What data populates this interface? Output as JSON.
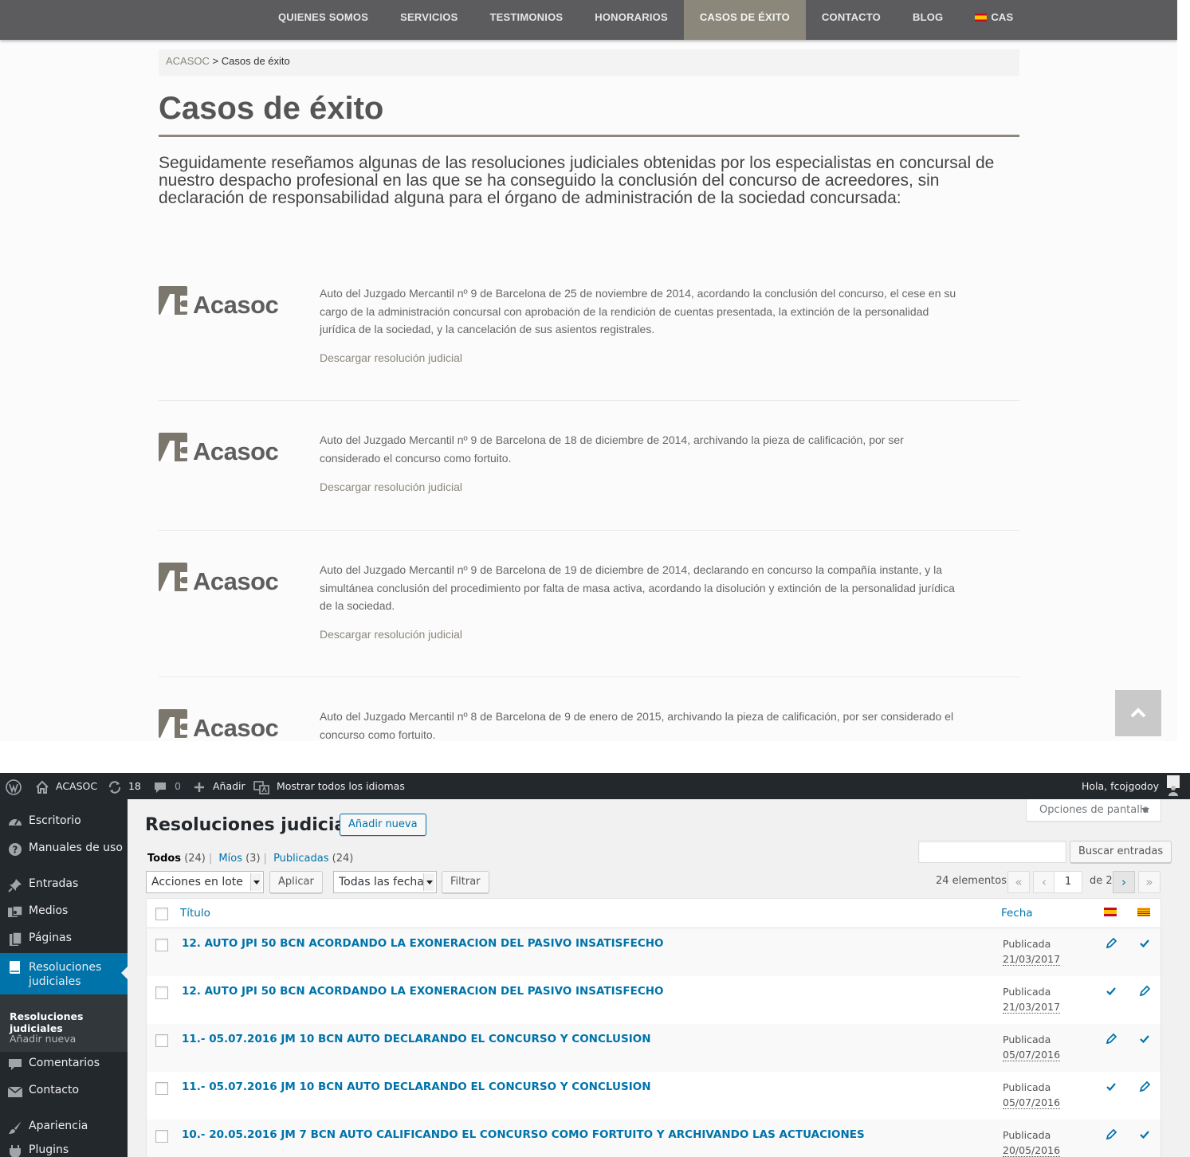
{
  "site": {
    "nav": [
      {
        "label": "QUIENES SOMOS",
        "active": false
      },
      {
        "label": "SERVICIOS",
        "active": false
      },
      {
        "label": "TESTIMONIOS",
        "active": false
      },
      {
        "label": "HONORARIOS",
        "active": false
      },
      {
        "label": "CASOS DE ÉXITO",
        "active": true
      },
      {
        "label": "CONTACTO",
        "active": false
      },
      {
        "label": "BLOG",
        "active": false
      }
    ],
    "language": "CAS",
    "breadcrumb": {
      "home": "ACASOC",
      "separator": ">",
      "current": "Casos de éxito"
    },
    "title": "Casos de éxito",
    "intro": "Seguidamente reseñamos algunas de las resoluciones judiciales obtenidas por los especialistas en concursal de nuestro despacho profesional en las que se ha conseguido la conclusión del concurso de acreedores, sin declaración de responsabilidad alguna para el órgano de administración de la sociedad concursada:",
    "logo_text": "Acasoc",
    "download_label": "Descargar resolución judicial",
    "cases": [
      {
        "text": "Auto del Juzgado Mercantil nº 9 de Barcelona de 25 de noviembre de 2014, acordando la conclusión del concurso, el cese en su cargo de la administración concursal con aprobación de la rendición de cuentas presentada, la extinción de la personalidad jurídica de la sociedad, y la cancelación de sus asientos registrales."
      },
      {
        "text": "Auto del Juzgado Mercantil nº 9 de Barcelona de 18 de diciembre de 2014, archivando la pieza de calificación, por ser considerado el concurso como fortuito."
      },
      {
        "text": "Auto del Juzgado Mercantil nº 9 de Barcelona de 19 de diciembre de 2014, declarando en concurso la compañía instante, y la simultánea conclusión del procedimiento por falta de masa activa, acordando la disolución y extinción de la personalidad jurídica de la sociedad."
      },
      {
        "text": "Auto del Juzgado Mercantil nº 8 de Barcelona de 9 de enero de 2015, archivando la pieza de calificación, por ser considerado el concurso como fortuito."
      }
    ],
    "colors": {
      "nav_bg": "#5c5c5e",
      "accent": "#8b877a",
      "text": "#666666"
    }
  },
  "admin": {
    "adminbar": {
      "site_name": "ACASOC",
      "updates": "18",
      "comments": "0",
      "new_label": "Añadir",
      "languages_label": "Mostrar todos los idiomas",
      "greeting": "Hola, fcojgodoy"
    },
    "sidebar": {
      "items": [
        {
          "label": "Escritorio",
          "icon": "dashboard-icon"
        },
        {
          "label": "Manuales de uso",
          "icon": "help-icon"
        },
        {
          "label": "Entradas",
          "icon": "pin-icon"
        },
        {
          "label": "Medios",
          "icon": "media-icon"
        },
        {
          "label": "Páginas",
          "icon": "pages-icon"
        },
        {
          "label": "Resoluciones judiciales",
          "icon": "book-icon",
          "current": true
        },
        {
          "label": "Comentarios",
          "icon": "comment-icon"
        },
        {
          "label": "Contacto",
          "icon": "mail-icon"
        },
        {
          "label": "Apariencia",
          "icon": "brush-icon"
        },
        {
          "label": "Plugins",
          "icon": "plugin-icon"
        }
      ],
      "submenu": [
        {
          "label": "Resoluciones judiciales",
          "active": true
        },
        {
          "label": "Añadir nueva",
          "active": false
        }
      ]
    },
    "page_title": "Resoluciones judiciales",
    "add_new": "Añadir nueva",
    "screen_options": "Opciones de pantalla",
    "views": [
      {
        "label": "Todos",
        "count": "(24)",
        "current": true
      },
      {
        "label": "Míos",
        "count": "(3)",
        "current": false
      },
      {
        "label": "Publicadas",
        "count": "(24)",
        "current": false
      }
    ],
    "search_button": "Buscar entradas",
    "bulk_actions": "Acciones en lote",
    "apply": "Aplicar",
    "date_filter": "Todas las fechas",
    "filter": "Filtrar",
    "pagination": {
      "count": "24 elementos",
      "first": "«",
      "prev": "‹",
      "current": "1",
      "of": "de 2",
      "next": "›",
      "last": "»"
    },
    "columns": {
      "title": "Título",
      "date": "Fecha"
    },
    "rows": [
      {
        "title": "12. AUTO JPI 50 BCN ACORDANDO LA EXONERACION DEL PASIVO INSATISFECHO",
        "status": "Publicada",
        "date": "21/03/2017",
        "es": "edit",
        "ca": "check"
      },
      {
        "title": "12. AUTO JPI 50 BCN ACORDANDO LA EXONERACION DEL PASIVO INSATISFECHO",
        "status": "Publicada",
        "date": "21/03/2017",
        "es": "check",
        "ca": "edit"
      },
      {
        "title": "11.- 05.07.2016 JM 10 BCN AUTO DECLARANDO EL CONCURSO Y CONCLUSION",
        "status": "Publicada",
        "date": "05/07/2016",
        "es": "edit",
        "ca": "check"
      },
      {
        "title": "11.- 05.07.2016 JM 10 BCN AUTO DECLARANDO EL CONCURSO Y CONCLUSION",
        "status": "Publicada",
        "date": "05/07/2016",
        "es": "check",
        "ca": "edit"
      },
      {
        "title": "10.- 20.05.2016 JM 7 BCN AUTO CALIFICANDO EL CONCURSO COMO FORTUITO Y ARCHIVANDO LAS ACTUACIONES",
        "status": "Publicada",
        "date": "20/05/2016",
        "es": "edit",
        "ca": "check"
      }
    ],
    "colors": {
      "adminbar": "#23282d",
      "sidebar": "#23282d",
      "link": "#0073aa",
      "current": "#0073aa"
    }
  }
}
